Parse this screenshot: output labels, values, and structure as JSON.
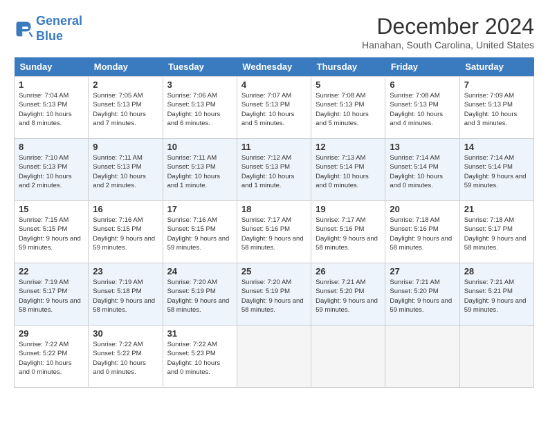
{
  "header": {
    "logo_line1": "General",
    "logo_line2": "Blue",
    "month": "December 2024",
    "location": "Hanahan, South Carolina, United States"
  },
  "days_of_week": [
    "Sunday",
    "Monday",
    "Tuesday",
    "Wednesday",
    "Thursday",
    "Friday",
    "Saturday"
  ],
  "weeks": [
    [
      {
        "day": "1",
        "sunrise": "7:04 AM",
        "sunset": "5:13 PM",
        "daylight": "10 hours and 8 minutes."
      },
      {
        "day": "2",
        "sunrise": "7:05 AM",
        "sunset": "5:13 PM",
        "daylight": "10 hours and 7 minutes."
      },
      {
        "day": "3",
        "sunrise": "7:06 AM",
        "sunset": "5:13 PM",
        "daylight": "10 hours and 6 minutes."
      },
      {
        "day": "4",
        "sunrise": "7:07 AM",
        "sunset": "5:13 PM",
        "daylight": "10 hours and 5 minutes."
      },
      {
        "day": "5",
        "sunrise": "7:08 AM",
        "sunset": "5:13 PM",
        "daylight": "10 hours and 5 minutes."
      },
      {
        "day": "6",
        "sunrise": "7:08 AM",
        "sunset": "5:13 PM",
        "daylight": "10 hours and 4 minutes."
      },
      {
        "day": "7",
        "sunrise": "7:09 AM",
        "sunset": "5:13 PM",
        "daylight": "10 hours and 3 minutes."
      }
    ],
    [
      {
        "day": "8",
        "sunrise": "7:10 AM",
        "sunset": "5:13 PM",
        "daylight": "10 hours and 2 minutes."
      },
      {
        "day": "9",
        "sunrise": "7:11 AM",
        "sunset": "5:13 PM",
        "daylight": "10 hours and 2 minutes."
      },
      {
        "day": "10",
        "sunrise": "7:11 AM",
        "sunset": "5:13 PM",
        "daylight": "10 hours and 1 minute."
      },
      {
        "day": "11",
        "sunrise": "7:12 AM",
        "sunset": "5:13 PM",
        "daylight": "10 hours and 1 minute."
      },
      {
        "day": "12",
        "sunrise": "7:13 AM",
        "sunset": "5:14 PM",
        "daylight": "10 hours and 0 minutes."
      },
      {
        "day": "13",
        "sunrise": "7:14 AM",
        "sunset": "5:14 PM",
        "daylight": "10 hours and 0 minutes."
      },
      {
        "day": "14",
        "sunrise": "7:14 AM",
        "sunset": "5:14 PM",
        "daylight": "9 hours and 59 minutes."
      }
    ],
    [
      {
        "day": "15",
        "sunrise": "7:15 AM",
        "sunset": "5:15 PM",
        "daylight": "9 hours and 59 minutes."
      },
      {
        "day": "16",
        "sunrise": "7:16 AM",
        "sunset": "5:15 PM",
        "daylight": "9 hours and 59 minutes."
      },
      {
        "day": "17",
        "sunrise": "7:16 AM",
        "sunset": "5:15 PM",
        "daylight": "9 hours and 59 minutes."
      },
      {
        "day": "18",
        "sunrise": "7:17 AM",
        "sunset": "5:16 PM",
        "daylight": "9 hours and 58 minutes."
      },
      {
        "day": "19",
        "sunrise": "7:17 AM",
        "sunset": "5:16 PM",
        "daylight": "9 hours and 58 minutes."
      },
      {
        "day": "20",
        "sunrise": "7:18 AM",
        "sunset": "5:16 PM",
        "daylight": "9 hours and 58 minutes."
      },
      {
        "day": "21",
        "sunrise": "7:18 AM",
        "sunset": "5:17 PM",
        "daylight": "9 hours and 58 minutes."
      }
    ],
    [
      {
        "day": "22",
        "sunrise": "7:19 AM",
        "sunset": "5:17 PM",
        "daylight": "9 hours and 58 minutes."
      },
      {
        "day": "23",
        "sunrise": "7:19 AM",
        "sunset": "5:18 PM",
        "daylight": "9 hours and 58 minutes."
      },
      {
        "day": "24",
        "sunrise": "7:20 AM",
        "sunset": "5:19 PM",
        "daylight": "9 hours and 58 minutes."
      },
      {
        "day": "25",
        "sunrise": "7:20 AM",
        "sunset": "5:19 PM",
        "daylight": "9 hours and 58 minutes."
      },
      {
        "day": "26",
        "sunrise": "7:21 AM",
        "sunset": "5:20 PM",
        "daylight": "9 hours and 59 minutes."
      },
      {
        "day": "27",
        "sunrise": "7:21 AM",
        "sunset": "5:20 PM",
        "daylight": "9 hours and 59 minutes."
      },
      {
        "day": "28",
        "sunrise": "7:21 AM",
        "sunset": "5:21 PM",
        "daylight": "9 hours and 59 minutes."
      }
    ],
    [
      {
        "day": "29",
        "sunrise": "7:22 AM",
        "sunset": "5:22 PM",
        "daylight": "10 hours and 0 minutes."
      },
      {
        "day": "30",
        "sunrise": "7:22 AM",
        "sunset": "5:22 PM",
        "daylight": "10 hours and 0 minutes."
      },
      {
        "day": "31",
        "sunrise": "7:22 AM",
        "sunset": "5:23 PM",
        "daylight": "10 hours and 0 minutes."
      },
      null,
      null,
      null,
      null
    ]
  ],
  "labels": {
    "sunrise": "Sunrise:",
    "sunset": "Sunset:",
    "daylight": "Daylight:"
  }
}
